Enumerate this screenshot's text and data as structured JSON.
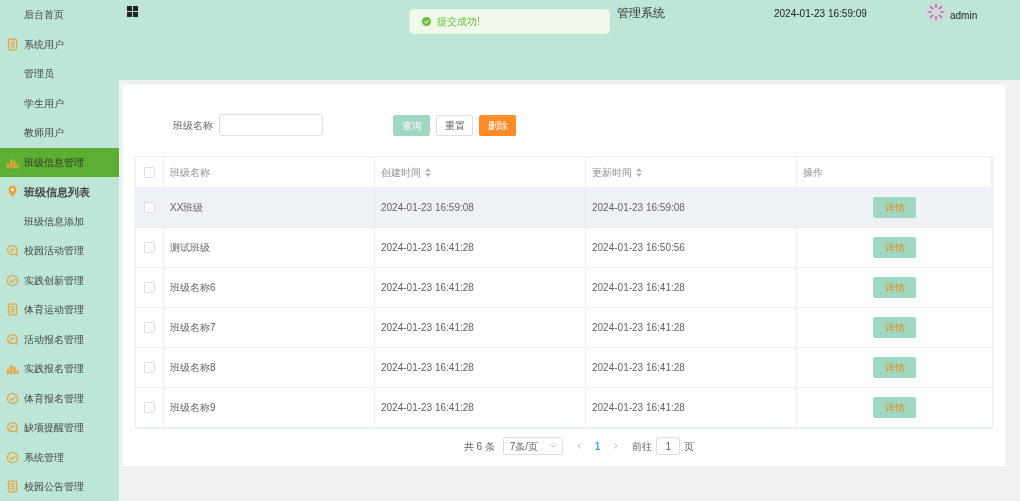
{
  "sidebar": {
    "items": [
      {
        "label": "后台首页",
        "kind": "plain",
        "selected": false
      },
      {
        "label": "系统用户",
        "kind": "doc",
        "selected": false
      },
      {
        "label": "管理员",
        "kind": "plain",
        "selected": false
      },
      {
        "label": "学生用户",
        "kind": "plain",
        "selected": false
      },
      {
        "label": "教师用户",
        "kind": "plain",
        "selected": false
      },
      {
        "label": "班级信息管理",
        "kind": "bar",
        "selected": true
      },
      {
        "label": "班级信息列表",
        "kind": "pin",
        "selected": true
      },
      {
        "label": "班级信息添加",
        "kind": "plain",
        "selected": false
      },
      {
        "label": "校园活动管理",
        "kind": "chat",
        "selected": false
      },
      {
        "label": "实践创新管理",
        "kind": "check",
        "selected": false
      },
      {
        "label": "体育运动管理",
        "kind": "doc",
        "selected": false
      },
      {
        "label": "活动报名管理",
        "kind": "chat",
        "selected": false
      },
      {
        "label": "实践报名管理",
        "kind": "bar",
        "selected": false
      },
      {
        "label": "体育报名管理",
        "kind": "check",
        "selected": false
      },
      {
        "label": "缺项提醒管理",
        "kind": "chat",
        "selected": false
      },
      {
        "label": "系统管理",
        "kind": "check",
        "selected": false
      },
      {
        "label": "校园公告管理",
        "kind": "doc",
        "selected": false
      }
    ]
  },
  "header": {
    "title": "管理系统",
    "datetime": "2024-01-23 16:59:09",
    "user": "admin"
  },
  "toast": {
    "kind": "success",
    "message": "提交成功!"
  },
  "search": {
    "label": "班级名称",
    "buttons": [
      {
        "label": "查询",
        "kind": "query"
      },
      {
        "label": "重置",
        "kind": "reset"
      },
      {
        "label": "删除",
        "kind": "delete"
      }
    ]
  },
  "table": {
    "header_checked": false,
    "columns": [
      {
        "label": "班级名称",
        "sortable": false
      },
      {
        "label": "创建时间",
        "sortable": true
      },
      {
        "label": "更新时间",
        "sortable": true
      },
      {
        "label": "操作",
        "sortable": false
      }
    ],
    "rows": [
      {
        "checked": false,
        "hovered": true,
        "name": "XX班级",
        "created": "2024-01-23 16:59:08",
        "updated": "2024-01-23 16:59:08",
        "action": "详情"
      },
      {
        "checked": false,
        "hovered": false,
        "name": "测试班级",
        "created": "2024-01-23 16:41:28",
        "updated": "2024-01-23 16:50:56",
        "action": "详情"
      },
      {
        "checked": false,
        "hovered": false,
        "name": "班级名称6",
        "created": "2024-01-23 16:41:28",
        "updated": "2024-01-23 16:41:28",
        "action": "详情"
      },
      {
        "checked": false,
        "hovered": false,
        "name": "班级名称7",
        "created": "2024-01-23 16:41:28",
        "updated": "2024-01-23 16:41:28",
        "action": "详情"
      },
      {
        "checked": false,
        "hovered": false,
        "name": "班级名称8",
        "created": "2024-01-23 16:41:28",
        "updated": "2024-01-23 16:41:28",
        "action": "详情"
      },
      {
        "checked": false,
        "hovered": false,
        "name": "班级名称9",
        "created": "2024-01-23 16:41:28",
        "updated": "2024-01-23 16:41:28",
        "action": "详情"
      }
    ]
  },
  "pagination": {
    "total": "共 6 条",
    "page_size": "7条/页",
    "pages": [
      {
        "label": "1",
        "selected": true
      }
    ],
    "goto_label": "前往",
    "goto_value": "1",
    "page_suffix": "页"
  }
}
